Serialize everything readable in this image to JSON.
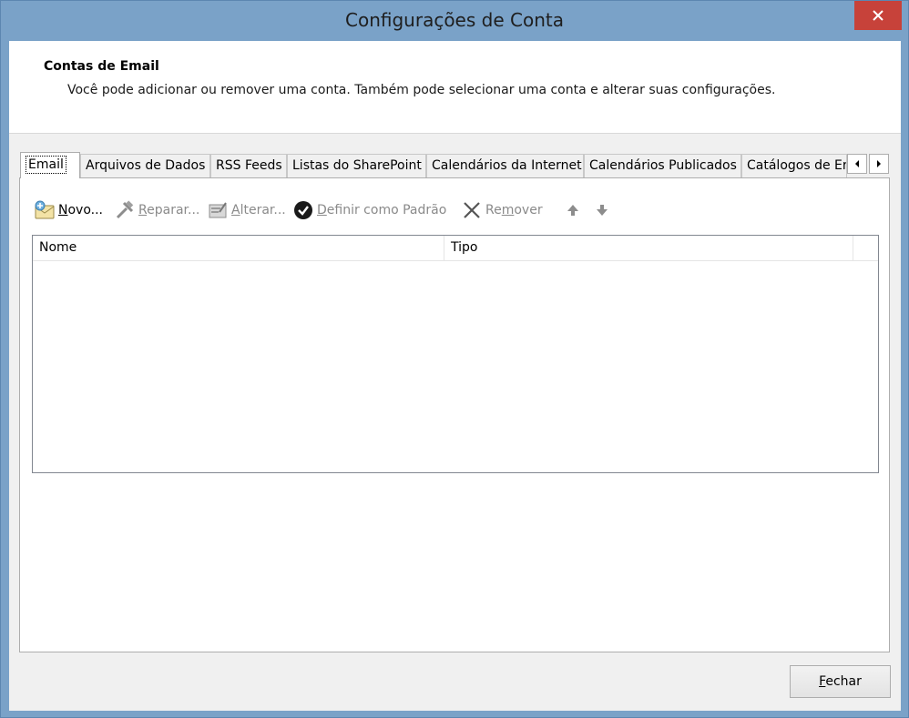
{
  "window": {
    "title": "Configurações de Conta",
    "close_glyph": "✕"
  },
  "header": {
    "title": "Contas de Email",
    "description": "Você pode adicionar ou remover uma conta. Também pode selecionar uma conta e alterar suas configurações."
  },
  "tabs": [
    {
      "label": "Email",
      "active": true
    },
    {
      "label": "Arquivos de Dados",
      "active": false
    },
    {
      "label": "RSS Feeds",
      "active": false
    },
    {
      "label": "Listas do SharePoint",
      "active": false
    },
    {
      "label": "Calendários da Internet",
      "active": false
    },
    {
      "label": "Calendários Publicados",
      "active": false
    },
    {
      "label": "Catálogos de Er",
      "active": false
    }
  ],
  "toolbar": {
    "new_first": "N",
    "new_rest": "ovo...",
    "repair_first": "R",
    "repair_rest": "eparar...",
    "change_first": "A",
    "change_rest": "lterar...",
    "default_first": "D",
    "default_rest": "efinir como Padrão",
    "remove_pre": "Re",
    "remove_u": "m",
    "remove_post": "over"
  },
  "list": {
    "columns": [
      "Nome",
      "Tipo"
    ],
    "rows": []
  },
  "footer": {
    "close_first": "F",
    "close_rest": "echar"
  },
  "colors": {
    "titlebar": "#7aa2c8",
    "close_red": "#c7423a"
  }
}
